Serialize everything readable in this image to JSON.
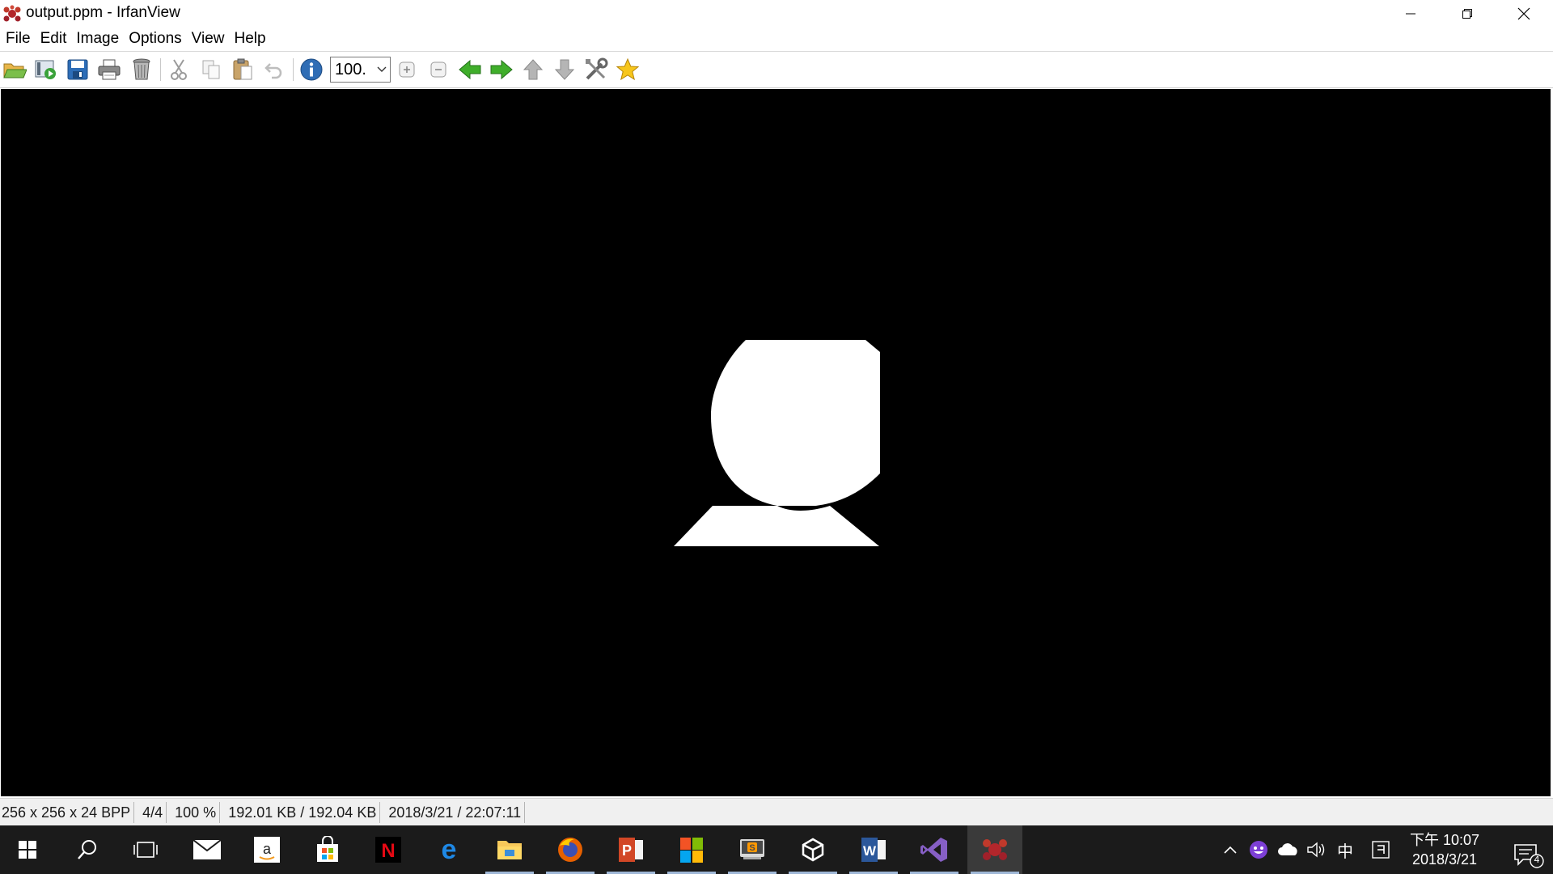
{
  "window": {
    "title": "output.ppm - IrfanView",
    "controls": [
      "minimize-icon",
      "restore-icon",
      "close-icon"
    ]
  },
  "menu": {
    "items": [
      {
        "label": "File"
      },
      {
        "label": "Edit"
      },
      {
        "label": "Image"
      },
      {
        "label": "Options"
      },
      {
        "label": "View"
      },
      {
        "label": "Help"
      }
    ]
  },
  "toolbar": {
    "buttons": [
      "open-folder-icon",
      "slideshow-icon",
      "save-icon",
      "print-icon",
      "delete-icon",
      "cut-icon",
      "copy-icon",
      "paste-icon",
      "undo-icon",
      "info-icon",
      "zoom-in-icon",
      "zoom-out-icon",
      "previous-icon",
      "next-icon",
      "previous-folder-icon",
      "next-folder-icon",
      "properties-icon",
      "favorites-icon"
    ],
    "zoom_value": "100."
  },
  "image": {
    "background_color": "#000000",
    "shape_color": "#ffffff"
  },
  "status": {
    "dimensions": "256 x 256 x 24 BPP",
    "index": "4/4",
    "zoom": "100 %",
    "size": "192.01 KB / 192.04 KB",
    "datetime": "2018/3/21 / 22:07:11"
  },
  "taskbar": {
    "apps": [
      "start-icon",
      "search-icon",
      "task-view-icon",
      "mail-icon",
      "amazon-icon",
      "store-icon",
      "netflix-icon",
      "edge-icon",
      "file-explorer-icon",
      "firefox-icon",
      "powerpoint-icon",
      "office-icon",
      "sublime-text-icon",
      "unity-icon",
      "word-icon",
      "visual-studio-icon",
      "irfanview-icon"
    ],
    "tray_icons": [
      "chevron-up-icon",
      "emoji-icon",
      "onedrive-icon",
      "volume-icon",
      "ime-chinese-icon",
      "ime-mode-icon"
    ],
    "ime_label": "中",
    "clock_time": "下午 10:07",
    "clock_date": "2018/3/21",
    "notification_count": "4"
  },
  "colors": {
    "taskbar": "#1b1b1b",
    "statusbar": "#f0f0f0",
    "accent": "#2f6db5"
  }
}
